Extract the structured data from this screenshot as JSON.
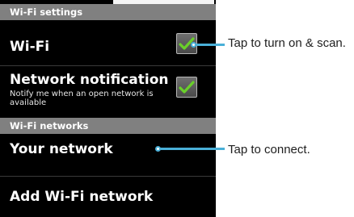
{
  "wifi_settings": {
    "header": "Wi-Fi settings",
    "wifi": {
      "label": "Wi-Fi",
      "checked": true
    },
    "network_notification": {
      "label": "Network notification",
      "summary": "Notify me when an open network is available",
      "checked": true
    }
  },
  "wifi_networks": {
    "header": "Wi-Fi networks",
    "items": [
      {
        "label": "Your network"
      },
      {
        "label": "Add Wi-Fi network"
      }
    ]
  },
  "callouts": [
    {
      "text": "Tap to turn on & scan."
    },
    {
      "text": "Tap to connect."
    }
  ],
  "colors": {
    "screen_bg": "#000000",
    "section_header_bg": "#808080",
    "check_green": "#6ad02a",
    "callout_line": "#4ab0d8"
  },
  "icons": {
    "checkbox": "check-icon"
  }
}
